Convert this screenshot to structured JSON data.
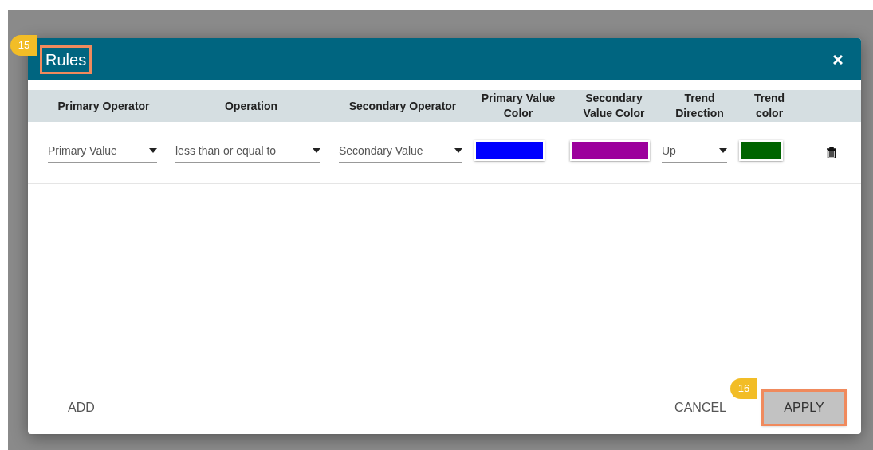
{
  "dialog": {
    "title": "Rules",
    "title_callout": "15",
    "columns": [
      "Primary Operator",
      "Operation",
      "Secondary Operator",
      "Primary Value Color",
      "Secondary Value Color",
      "Trend Direction",
      "Trend color"
    ],
    "rows": [
      {
        "primary_operator": "Primary Value",
        "operation": "less than or equal to",
        "secondary_operator": "Secondary Value",
        "primary_value_swatch": {
          "color": "#0000ff"
        },
        "secondary_value_swatch": {
          "color": "#9c009c"
        },
        "trend_direction": "Up",
        "trend_swatch": {
          "color": "#006400"
        }
      }
    ],
    "add_button": "ADD",
    "cancel_button": "CANCEL",
    "apply_button": "APPLY",
    "apply_callout": "16"
  }
}
